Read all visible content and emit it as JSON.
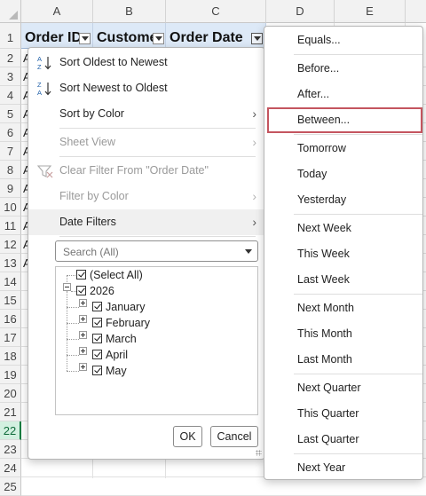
{
  "sheet": {
    "columns": [
      "A",
      "B",
      "C",
      "D",
      "E"
    ],
    "rows": [
      "1",
      "2",
      "3",
      "4",
      "5",
      "6",
      "7",
      "8",
      "9",
      "10",
      "11",
      "12",
      "13",
      "14",
      "15",
      "16",
      "17",
      "18",
      "19",
      "20",
      "21",
      "22",
      "23",
      "24",
      "25"
    ],
    "selected_row": "22",
    "headers": [
      "Order ID",
      "Customer",
      "Order Date"
    ],
    "peek_letter": "A"
  },
  "filter_menu": {
    "items": [
      {
        "label": "Sort Oldest to Newest",
        "icon": "sort-ascending-icon",
        "disabled": false
      },
      {
        "label": "Sort Newest to Oldest",
        "icon": "sort-descending-icon",
        "disabled": false
      },
      {
        "label": "Sort by Color",
        "disabled": false,
        "submenu": true
      },
      {
        "label": "Sheet View",
        "disabled": true,
        "submenu": true
      },
      {
        "label": "Clear Filter From \"Order Date\"",
        "icon": "clear-filter-icon",
        "disabled": true
      },
      {
        "label": "Filter by Color",
        "disabled": true,
        "submenu": true
      },
      {
        "label": "Date Filters",
        "disabled": false,
        "submenu": true,
        "hover": true
      }
    ],
    "search_placeholder": "Search (All)",
    "tree": {
      "select_all": "(Select All)",
      "year": "2026",
      "months": [
        "January",
        "February",
        "March",
        "April",
        "May"
      ]
    },
    "ok_label": "OK",
    "cancel_label": "Cancel"
  },
  "date_filters_submenu": {
    "items": [
      "Equals...",
      "Before...",
      "After...",
      "Between...",
      "Tomorrow",
      "Today",
      "Yesterday",
      "Next Week",
      "This Week",
      "Last Week",
      "Next Month",
      "This Month",
      "Last Month",
      "Next Quarter",
      "This Quarter",
      "Last Quarter",
      "Next Year"
    ],
    "highlighted": "Between..."
  },
  "colors": {
    "header_fill": "#dde9f7",
    "highlight_border": "#c4555f",
    "selected_row_fill": "#d3f0e0"
  }
}
